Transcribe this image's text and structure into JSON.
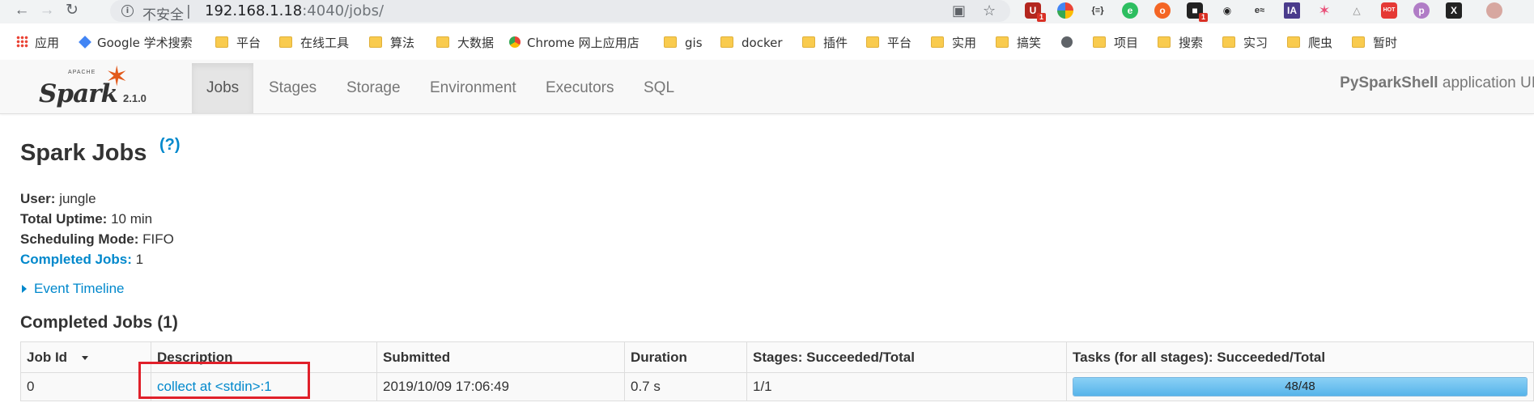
{
  "browser": {
    "security_label": "不安全",
    "url_host": "192.168.1.18",
    "url_rest": ":4040/jobs/",
    "extension_badges": [
      "1",
      "1"
    ],
    "bookmarks": [
      "应用",
      "Google 学术搜索",
      "平台",
      "在线工具",
      "算法",
      "大数据",
      "Chrome 网上应用店",
      "gis",
      "docker",
      "插件",
      "平台",
      "实用",
      "搞笑",
      "项目",
      "搜索",
      "实习",
      "爬虫",
      "暂时"
    ]
  },
  "spark": {
    "version": "2.1.0",
    "logo_text": "Spark",
    "logo_apache": "APACHE",
    "tabs": [
      "Jobs",
      "Stages",
      "Storage",
      "Environment",
      "Executors",
      "SQL"
    ],
    "active_tab": "Jobs",
    "app_name": "PySparkShell",
    "app_suffix": " application UI"
  },
  "page": {
    "title": "Spark Jobs",
    "help": "(?)",
    "user_label": "User:",
    "user_value": " jungle",
    "uptime_label": "Total Uptime:",
    "uptime_value": " 10 min",
    "mode_label": "Scheduling Mode:",
    "mode_value": " FIFO",
    "completed_label": "Completed Jobs:",
    "completed_value": " 1",
    "event_timeline": "Event Timeline",
    "section_title": "Completed Jobs (1)"
  },
  "table": {
    "headers": [
      "Job Id",
      "Description",
      "Submitted",
      "Duration",
      "Stages: Succeeded/Total",
      "Tasks (for all stages): Succeeded/Total"
    ],
    "rows": [
      {
        "job_id": "0",
        "description": "collect at <stdin>:1",
        "submitted": "2019/10/09 17:06:49",
        "duration": "0.7 s",
        "stages": "1/1",
        "tasks": "48/48",
        "tasks_fraction": 1.0
      }
    ]
  },
  "colors": {
    "link": "#0088cc",
    "highlight": "#e0202a",
    "spark_orange": "#e25a1c"
  }
}
